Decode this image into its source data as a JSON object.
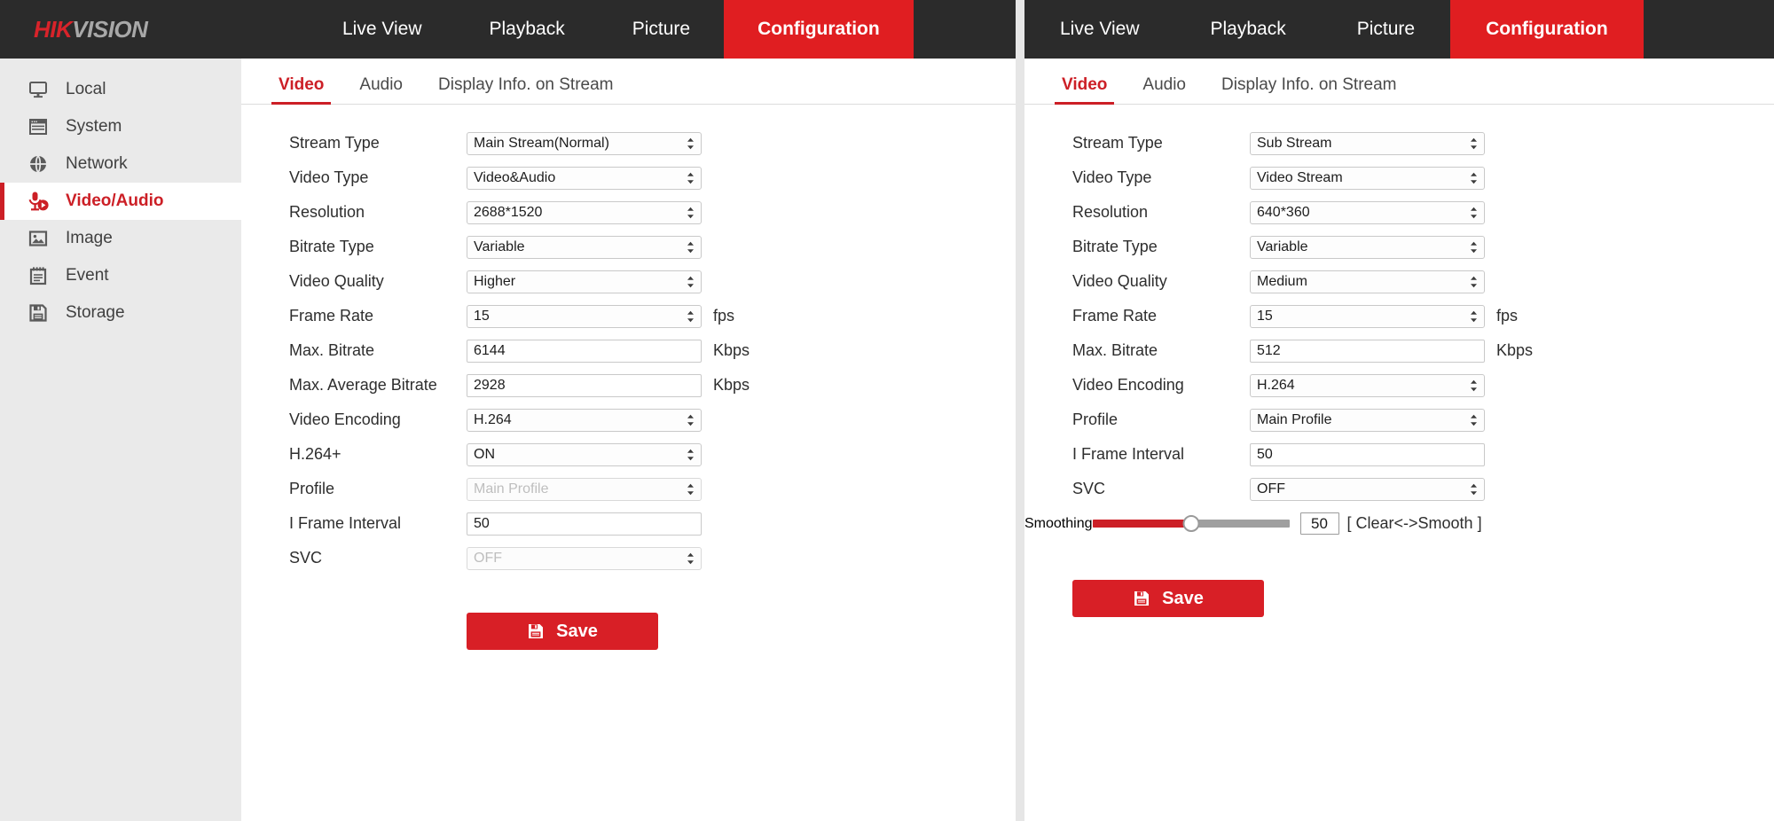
{
  "brand": {
    "part1": "HIK",
    "part2": "VISION"
  },
  "nav": {
    "items": [
      {
        "label": "Live View",
        "active": false
      },
      {
        "label": "Playback",
        "active": false
      },
      {
        "label": "Picture",
        "active": false
      },
      {
        "label": "Configuration",
        "active": true
      }
    ]
  },
  "sidebar": {
    "items": [
      {
        "label": "Local",
        "icon": "monitor-icon",
        "active": false
      },
      {
        "label": "System",
        "icon": "window-icon",
        "active": false
      },
      {
        "label": "Network",
        "icon": "globe-icon",
        "active": false
      },
      {
        "label": "Video/Audio",
        "icon": "video-audio-icon",
        "active": true
      },
      {
        "label": "Image",
        "icon": "picture-icon",
        "active": false
      },
      {
        "label": "Event",
        "icon": "calendar-icon",
        "active": false
      },
      {
        "label": "Storage",
        "icon": "floppy-icon",
        "active": false
      }
    ]
  },
  "tabs": [
    {
      "label": "Video",
      "active": true
    },
    {
      "label": "Audio",
      "active": false
    },
    {
      "label": "Display Info. on Stream",
      "active": false
    }
  ],
  "left_panel": {
    "fields": [
      {
        "label": "Stream Type",
        "value": "Main Stream(Normal)",
        "type": "select",
        "unit": "",
        "disabled": false
      },
      {
        "label": "Video Type",
        "value": "Video&Audio",
        "type": "select",
        "unit": "",
        "disabled": false
      },
      {
        "label": "Resolution",
        "value": "2688*1520",
        "type": "select",
        "unit": "",
        "disabled": false
      },
      {
        "label": "Bitrate Type",
        "value": "Variable",
        "type": "select",
        "unit": "",
        "disabled": false
      },
      {
        "label": "Video Quality",
        "value": "Higher",
        "type": "select",
        "unit": "",
        "disabled": false
      },
      {
        "label": "Frame Rate",
        "value": "15",
        "type": "select",
        "unit": "fps",
        "disabled": false
      },
      {
        "label": "Max. Bitrate",
        "value": "6144",
        "type": "input",
        "unit": "Kbps",
        "disabled": false
      },
      {
        "label": "Max. Average Bitrate",
        "value": "2928",
        "type": "input",
        "unit": "Kbps",
        "disabled": false
      },
      {
        "label": "Video Encoding",
        "value": "H.264",
        "type": "select",
        "unit": "",
        "disabled": false
      },
      {
        "label": "H.264+",
        "value": "ON",
        "type": "select",
        "unit": "",
        "disabled": false
      },
      {
        "label": "Profile",
        "value": "Main Profile",
        "type": "select",
        "unit": "",
        "disabled": true
      },
      {
        "label": "I Frame Interval",
        "value": "50",
        "type": "input",
        "unit": "",
        "disabled": false
      },
      {
        "label": "SVC",
        "value": "OFF",
        "type": "select",
        "unit": "",
        "disabled": true
      }
    ],
    "save_label": "Save"
  },
  "right_panel": {
    "fields": [
      {
        "label": "Stream Type",
        "value": "Sub Stream",
        "type": "select",
        "unit": "",
        "disabled": false
      },
      {
        "label": "Video Type",
        "value": "Video Stream",
        "type": "select",
        "unit": "",
        "disabled": false
      },
      {
        "label": "Resolution",
        "value": "640*360",
        "type": "select",
        "unit": "",
        "disabled": false
      },
      {
        "label": "Bitrate Type",
        "value": "Variable",
        "type": "select",
        "unit": "",
        "disabled": false
      },
      {
        "label": "Video Quality",
        "value": "Medium",
        "type": "select",
        "unit": "",
        "disabled": false
      },
      {
        "label": "Frame Rate",
        "value": "15",
        "type": "select",
        "unit": "fps",
        "disabled": false
      },
      {
        "label": "Max. Bitrate",
        "value": "512",
        "type": "input",
        "unit": "Kbps",
        "disabled": false
      },
      {
        "label": "Video Encoding",
        "value": "H.264",
        "type": "select",
        "unit": "",
        "disabled": false
      },
      {
        "label": "Profile",
        "value": "Main Profile",
        "type": "select",
        "unit": "",
        "disabled": false
      },
      {
        "label": "I Frame Interval",
        "value": "50",
        "type": "input",
        "unit": "",
        "disabled": false
      },
      {
        "label": "SVC",
        "value": "OFF",
        "type": "select",
        "unit": "",
        "disabled": false
      }
    ],
    "smoothing": {
      "label": "Smoothing",
      "value": "50",
      "percent": 50,
      "hint": "[ Clear<->Smooth ]"
    },
    "save_label": "Save"
  },
  "colors": {
    "brand_red": "#d8232a",
    "accent_red": "#cc1f26",
    "nav_bg": "#2b2b2b",
    "sidebar_bg": "#eaeaea"
  }
}
